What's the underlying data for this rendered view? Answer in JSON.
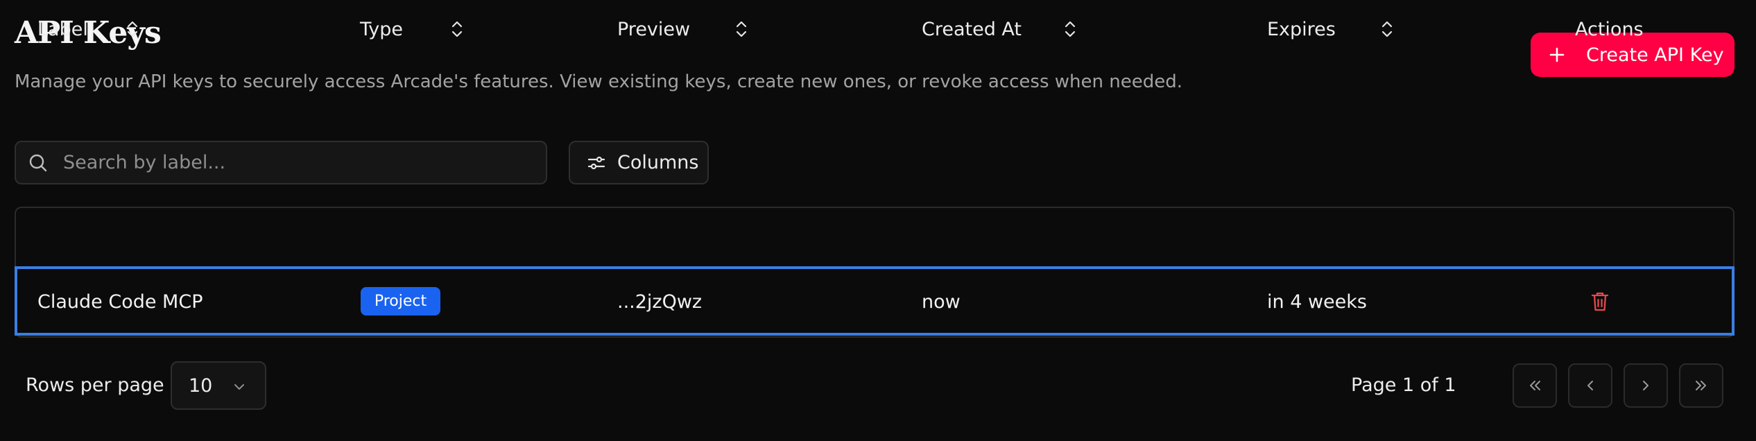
{
  "header": {
    "title": "API Keys",
    "subtitle": "Manage your API keys to securely access Arcade's features. View existing keys, create new ones, or revoke access when needed.",
    "create_label": "Create API Key"
  },
  "toolbar": {
    "search_placeholder": "Search by label...",
    "columns_label": "Columns"
  },
  "table": {
    "columns": [
      "Label",
      "Type",
      "Preview",
      "Created At",
      "Expires",
      "Actions"
    ],
    "rows": [
      {
        "label": "Claude Code MCP",
        "type": "Project",
        "preview": "...2jzQwz",
        "created_at": "now",
        "expires": "in 4 weeks"
      }
    ]
  },
  "footer": {
    "rows_per_page_label": "Rows per page",
    "rows_per_page_value": "10",
    "page_info": "Page 1 of 1"
  },
  "colors": {
    "background": "#0b0b0b",
    "accent": "#ff0044",
    "badge": "#1a63f0",
    "selection_border": "#3a7ee4",
    "delete": "#e5484d"
  },
  "icons": [
    "plus-icon",
    "search-icon",
    "sliders-icon",
    "sort-icon",
    "trash-icon",
    "chevron-down-icon",
    "chevrons-left-icon",
    "chevron-left-icon",
    "chevron-right-icon",
    "chevrons-right-icon"
  ]
}
